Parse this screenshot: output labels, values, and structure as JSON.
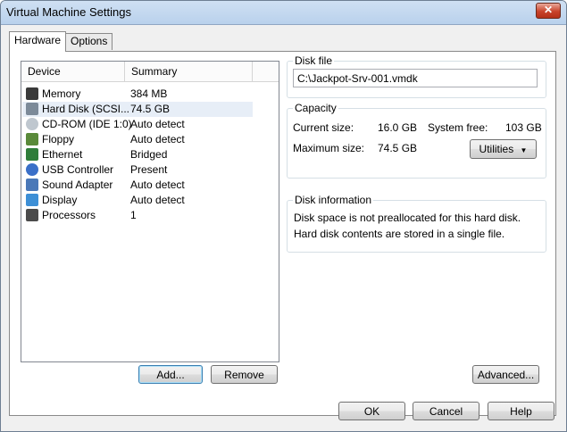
{
  "window": {
    "title": "Virtual Machine Settings",
    "close_glyph": "✕"
  },
  "tabs": [
    {
      "label": "Hardware",
      "active": true
    },
    {
      "label": "Options",
      "active": false
    }
  ],
  "device_list": {
    "headers": [
      "Device",
      "Summary"
    ],
    "rows": [
      {
        "icon": "memory-icon",
        "device": "Memory",
        "summary": "384 MB",
        "selected": false
      },
      {
        "icon": "hard-disk-icon",
        "device": "Hard Disk (SCSI...",
        "summary": "74.5 GB",
        "selected": true
      },
      {
        "icon": "cd-rom-icon",
        "device": "CD-ROM (IDE 1:0)",
        "summary": "Auto detect",
        "selected": false
      },
      {
        "icon": "floppy-icon",
        "device": "Floppy",
        "summary": "Auto detect",
        "selected": false
      },
      {
        "icon": "ethernet-icon",
        "device": "Ethernet",
        "summary": "Bridged",
        "selected": false
      },
      {
        "icon": "usb-controller-icon",
        "device": "USB Controller",
        "summary": "Present",
        "selected": false
      },
      {
        "icon": "sound-adapter-icon",
        "device": "Sound Adapter",
        "summary": "Auto detect",
        "selected": false
      },
      {
        "icon": "display-icon",
        "device": "Display",
        "summary": "Auto detect",
        "selected": false
      },
      {
        "icon": "processors-icon",
        "device": "Processors",
        "summary": "1",
        "selected": false
      }
    ]
  },
  "list_buttons": {
    "add": "Add...",
    "remove": "Remove"
  },
  "disk_file": {
    "label": "Disk file",
    "value": "C:\\Jackpot-Srv-001.vmdk"
  },
  "capacity": {
    "label": "Capacity",
    "current_size_label": "Current size:",
    "current_size_value": "16.0 GB",
    "system_free_label": "System free:",
    "system_free_value": "103 GB",
    "maximum_size_label": "Maximum size:",
    "maximum_size_value": "74.5 GB",
    "utilities_label": "Utilities",
    "utilities_arrow": "▼"
  },
  "disk_information": {
    "label": "Disk information",
    "line1": "Disk space is not preallocated for this hard disk.",
    "line2": "Hard disk contents are stored in a single file."
  },
  "advanced_button": "Advanced...",
  "footer": {
    "ok": "OK",
    "cancel": "Cancel",
    "help": "Help"
  },
  "colors": {
    "title_bar": "#c4d8ef",
    "close_button": "#c9432b",
    "selected_row": "#e7eef7"
  }
}
